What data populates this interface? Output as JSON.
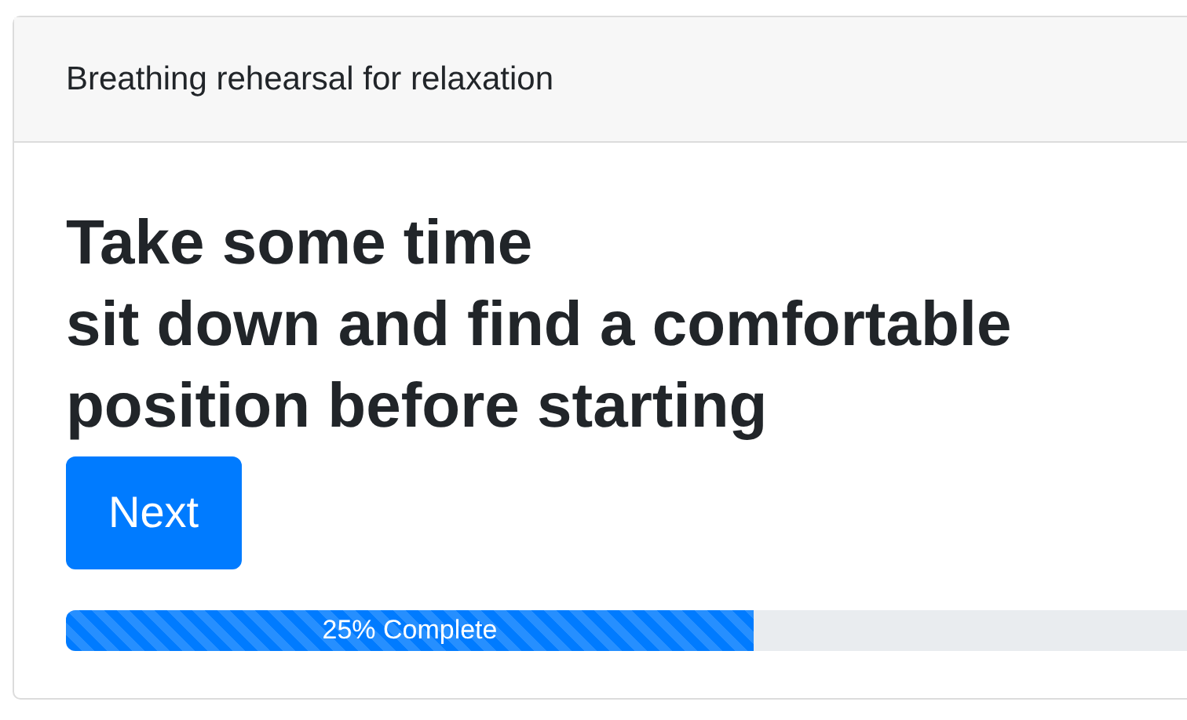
{
  "card": {
    "header": "Breathing rehearsal for relaxation",
    "heading_lines": [
      "Take some time",
      "sit down and find a comfortable",
      "position before starting"
    ],
    "button": "Next",
    "progress": {
      "level": 0.25,
      "label": "25% Complete",
      "striped": true
    }
  }
}
